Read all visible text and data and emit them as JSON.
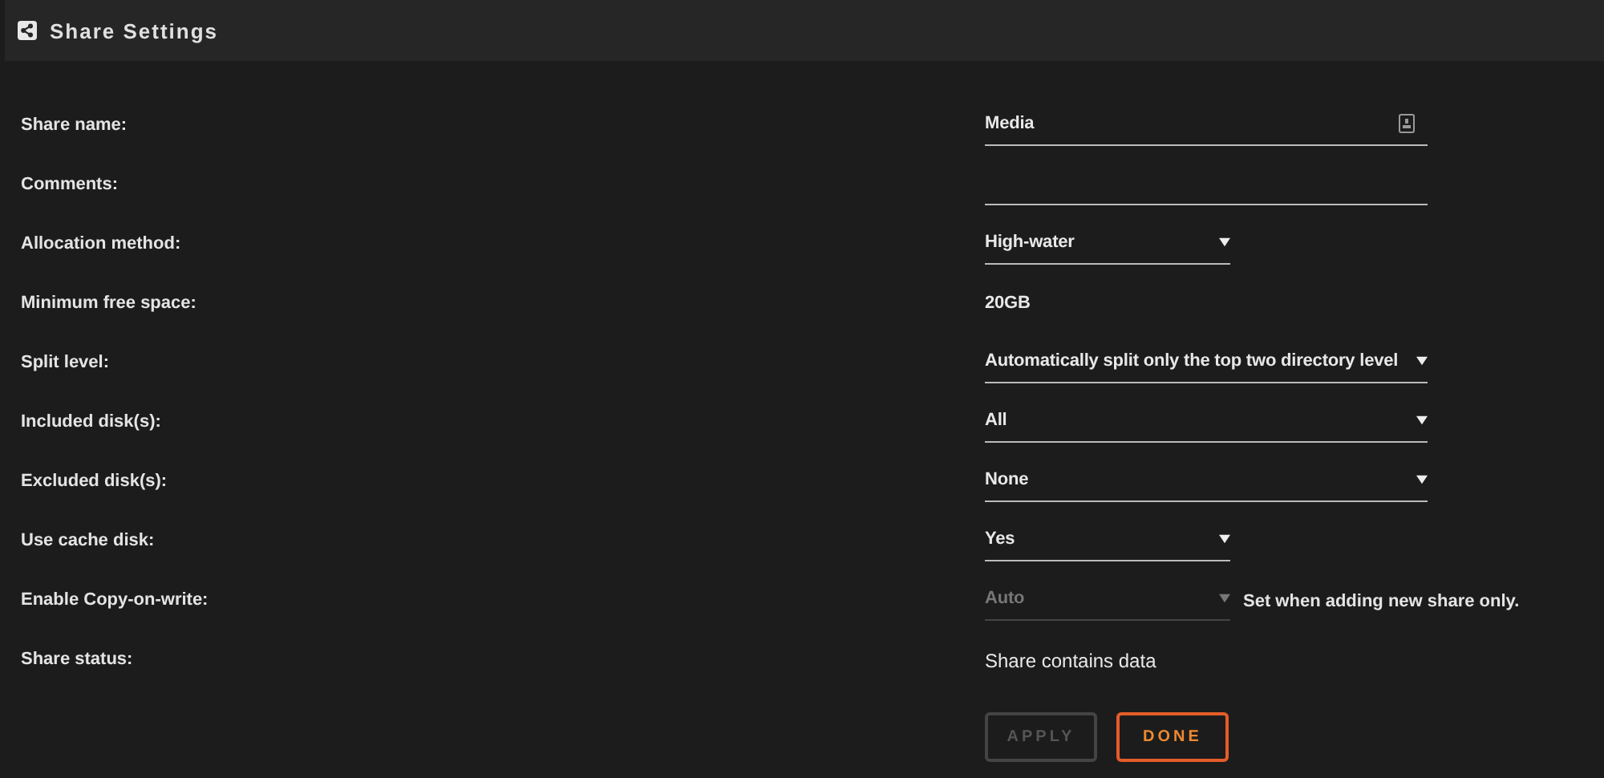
{
  "header": {
    "title": "Share Settings"
  },
  "rows": [
    {
      "label": "Share name:",
      "kind": "text",
      "value": "Media",
      "icon": true
    },
    {
      "label": "Comments:",
      "kind": "text",
      "value": ""
    },
    {
      "label": "Allocation method:",
      "kind": "select",
      "value": "High-water",
      "disabled": false
    },
    {
      "label": "Minimum free space:",
      "kind": "plain",
      "value": "20GB"
    },
    {
      "label": "Split level:",
      "kind": "longselect",
      "value": "Automatically split only the top two directory level",
      "disabled": false
    },
    {
      "label": "Included disk(s):",
      "kind": "longselect",
      "value": "All",
      "disabled": false
    },
    {
      "label": "Excluded disk(s):",
      "kind": "longselect",
      "value": "None",
      "disabled": false
    },
    {
      "label": "Use cache disk:",
      "kind": "select",
      "value": "Yes",
      "disabled": false
    },
    {
      "label": "Enable Copy-on-write:",
      "kind": "select",
      "value": "Auto",
      "disabled": true,
      "note": "Set when adding new share only."
    },
    {
      "label": "Share status:",
      "kind": "status",
      "value": "Share contains data"
    }
  ],
  "buttons": [
    {
      "label": "APPLY",
      "disabled": true
    },
    {
      "label": "DONE",
      "disabled": false
    }
  ]
}
